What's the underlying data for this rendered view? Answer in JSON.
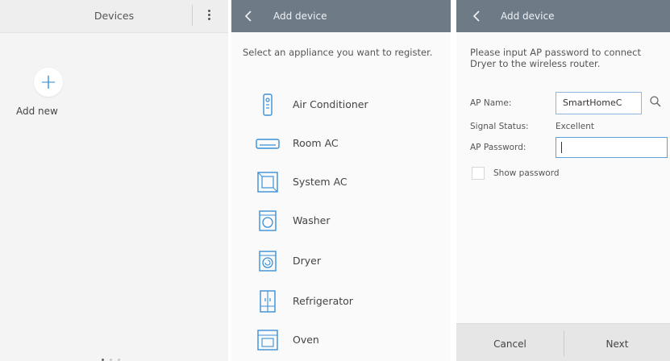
{
  "panel1": {
    "title": "Devices",
    "add_label": "Add new",
    "page_dots": 3,
    "active_dot": 0
  },
  "panel2": {
    "title": "Add device",
    "instruction": "Select an appliance you want to register.",
    "appliances": [
      {
        "label": "Air Conditioner",
        "icon": "air-conditioner-icon"
      },
      {
        "label": "Room AC",
        "icon": "room-ac-icon"
      },
      {
        "label": "System AC",
        "icon": "system-ac-icon"
      },
      {
        "label": "Washer",
        "icon": "washer-icon"
      },
      {
        "label": "Dryer",
        "icon": "dryer-icon"
      },
      {
        "label": "Refrigerator",
        "icon": "refrigerator-icon"
      },
      {
        "label": "Oven",
        "icon": "oven-icon"
      }
    ]
  },
  "panel3": {
    "title": "Add device",
    "instruction": "Please input AP password to connect Dryer to the wireless router.",
    "ap_name_label": "AP Name:",
    "ap_name_value": "SmartHomeC",
    "signal_label": "Signal Status:",
    "signal_value": "Excellent",
    "password_label": "AP Password:",
    "password_value": "",
    "show_password_label": "Show password",
    "show_password_checked": false,
    "cancel_label": "Cancel",
    "next_label": "Next"
  },
  "colors": {
    "header_bg": "#6e7a86",
    "accent_blue": "#2a8ad8",
    "icon_blue": "#3b8fd6"
  }
}
